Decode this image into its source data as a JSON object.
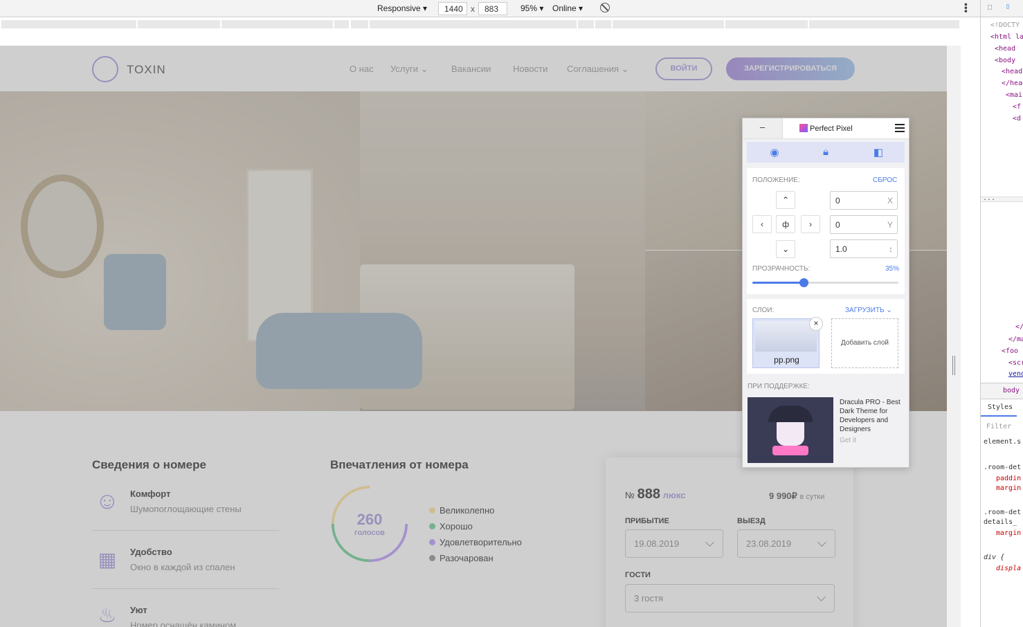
{
  "devtools": {
    "device": "Responsive",
    "width": "1440",
    "height": "883",
    "times": "x",
    "zoom": "95%",
    "network": "Online"
  },
  "site": {
    "logo_text": "TOXIN",
    "nav": [
      "О нас",
      "Услуги",
      "Вакансии",
      "Новости",
      "Соглашения"
    ],
    "login_label": "ВОЙТИ",
    "register_label": "ЗАРЕГИСТРИРОВАТЬСЯ"
  },
  "room_info": {
    "title": "Сведения о номере",
    "features": [
      {
        "icon": "smile-icon",
        "title": "Комфорт",
        "desc": "Шумопоглощающие стены"
      },
      {
        "icon": "building-icon",
        "title": "Удобство",
        "desc": "Окно в каждой из спален"
      },
      {
        "icon": "fire-icon",
        "title": "Уют",
        "desc": "Номер оснащён камином"
      }
    ]
  },
  "impressions": {
    "title": "Впечатления от номера",
    "votes": "260",
    "votes_label": "голосов",
    "legend": [
      {
        "label": "Великолепно",
        "color": "#ffe39c"
      },
      {
        "label": "Хорошо",
        "color": "#6fcf97"
      },
      {
        "label": "Удовлетворительно",
        "color": "#bc9cff"
      },
      {
        "label": "Разочарован",
        "color": "#919191"
      }
    ]
  },
  "booking": {
    "num_prefix": "№",
    "num": "888",
    "type": "люкс",
    "price": "9 990₽",
    "per": "в сутки",
    "arrival_label": "ПРИБЫТИЕ",
    "arrival": "19.08.2019",
    "departure_label": "ВЫЕЗД",
    "departure": "23.08.2019",
    "guests_label": "ГОСТИ",
    "guests": "3 гостя"
  },
  "perfect_pixel": {
    "minimize": "–",
    "brand": "Perfect Pixel",
    "position_label": "ПОЛОЖЕНИЕ:",
    "reset_label": "СБРОС",
    "x_value": "0",
    "x_suffix": "X",
    "y_value": "0",
    "y_suffix": "Y",
    "scale_value": "1.0",
    "center_label": "ф",
    "opacity_label": "ПРОЗРАЧНОСТЬ:",
    "opacity_value": "35%",
    "opacity": 0.35,
    "layers_label": "СЛОИ:",
    "upload_label": "ЗАГРУЗИТЬ",
    "layer_name": "pp.png",
    "add_layer": "Добавить слой",
    "sponsor_label": "ПРИ ПОДДЕРЖКЕ:",
    "ad_text": "Dracula PRO - Best Dark Theme for Developers and Designers",
    "ad_link": "Get it"
  },
  "side": {
    "lines": [
      "<!DOCTY",
      "<html la",
      "<head",
      "<body",
      "<head",
      "</head",
      "<mai",
      "<f",
      "<d",
      "",
      "...",
      "</",
      "</ma",
      "<foo",
      "<scr",
      "vend"
    ],
    "crumb": "body",
    "styles_tab": "Styles",
    "filter": "Filter",
    "rules": [
      ".room-det",
      "paddin",
      "margin",
      ".room-det",
      "details_",
      "margin",
      "div {",
      "displa"
    ]
  }
}
